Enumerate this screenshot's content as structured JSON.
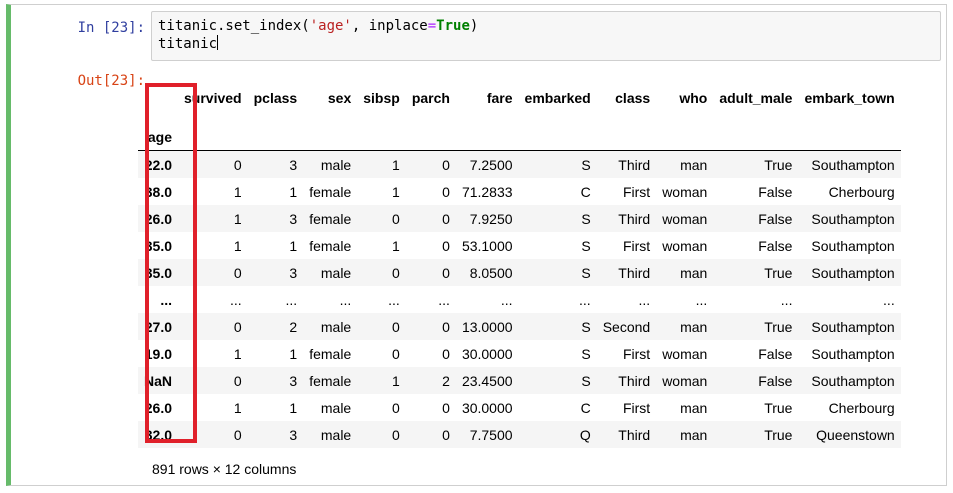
{
  "cell": {
    "in_prompt": "In [23]:",
    "out_prompt": "Out[23]:",
    "code": {
      "line1_obj": "titanic.set_index(",
      "line1_str": "'age'",
      "line1_mid": ", inplace",
      "line1_eq": "=",
      "line1_kw": "True",
      "line1_end": ")",
      "line2": "titanic"
    }
  },
  "dataframe": {
    "index_name": "age",
    "columns": [
      "survived",
      "pclass",
      "sex",
      "sibsp",
      "parch",
      "fare",
      "embarked",
      "class",
      "who",
      "adult_male",
      "embark_town"
    ],
    "rows": [
      {
        "index": "22.0",
        "values": [
          "0",
          "3",
          "male",
          "1",
          "0",
          "7.2500",
          "S",
          "Third",
          "man",
          "True",
          "Southampton"
        ]
      },
      {
        "index": "38.0",
        "values": [
          "1",
          "1",
          "female",
          "1",
          "0",
          "71.2833",
          "C",
          "First",
          "woman",
          "False",
          "Cherbourg"
        ]
      },
      {
        "index": "26.0",
        "values": [
          "1",
          "3",
          "female",
          "0",
          "0",
          "7.9250",
          "S",
          "Third",
          "woman",
          "False",
          "Southampton"
        ]
      },
      {
        "index": "35.0",
        "values": [
          "1",
          "1",
          "female",
          "1",
          "0",
          "53.1000",
          "S",
          "First",
          "woman",
          "False",
          "Southampton"
        ]
      },
      {
        "index": "35.0",
        "values": [
          "0",
          "3",
          "male",
          "0",
          "0",
          "8.0500",
          "S",
          "Third",
          "man",
          "True",
          "Southampton"
        ]
      },
      {
        "index": "...",
        "values": [
          "...",
          "...",
          "...",
          "...",
          "...",
          "...",
          "...",
          "...",
          "...",
          "...",
          "..."
        ]
      },
      {
        "index": "27.0",
        "values": [
          "0",
          "2",
          "male",
          "0",
          "0",
          "13.0000",
          "S",
          "Second",
          "man",
          "True",
          "Southampton"
        ]
      },
      {
        "index": "19.0",
        "values": [
          "1",
          "1",
          "female",
          "0",
          "0",
          "30.0000",
          "S",
          "First",
          "woman",
          "False",
          "Southampton"
        ]
      },
      {
        "index": "NaN",
        "values": [
          "0",
          "3",
          "female",
          "1",
          "2",
          "23.4500",
          "S",
          "Third",
          "woman",
          "False",
          "Southampton"
        ]
      },
      {
        "index": "26.0",
        "values": [
          "1",
          "1",
          "male",
          "0",
          "0",
          "30.0000",
          "C",
          "First",
          "man",
          "True",
          "Cherbourg"
        ]
      },
      {
        "index": "32.0",
        "values": [
          "0",
          "3",
          "male",
          "0",
          "0",
          "7.7500",
          "Q",
          "Third",
          "man",
          "True",
          "Queenstown"
        ]
      }
    ],
    "footer": "891 rows × 12 columns"
  },
  "annotation": {
    "highlight_color": "#e0202a"
  }
}
